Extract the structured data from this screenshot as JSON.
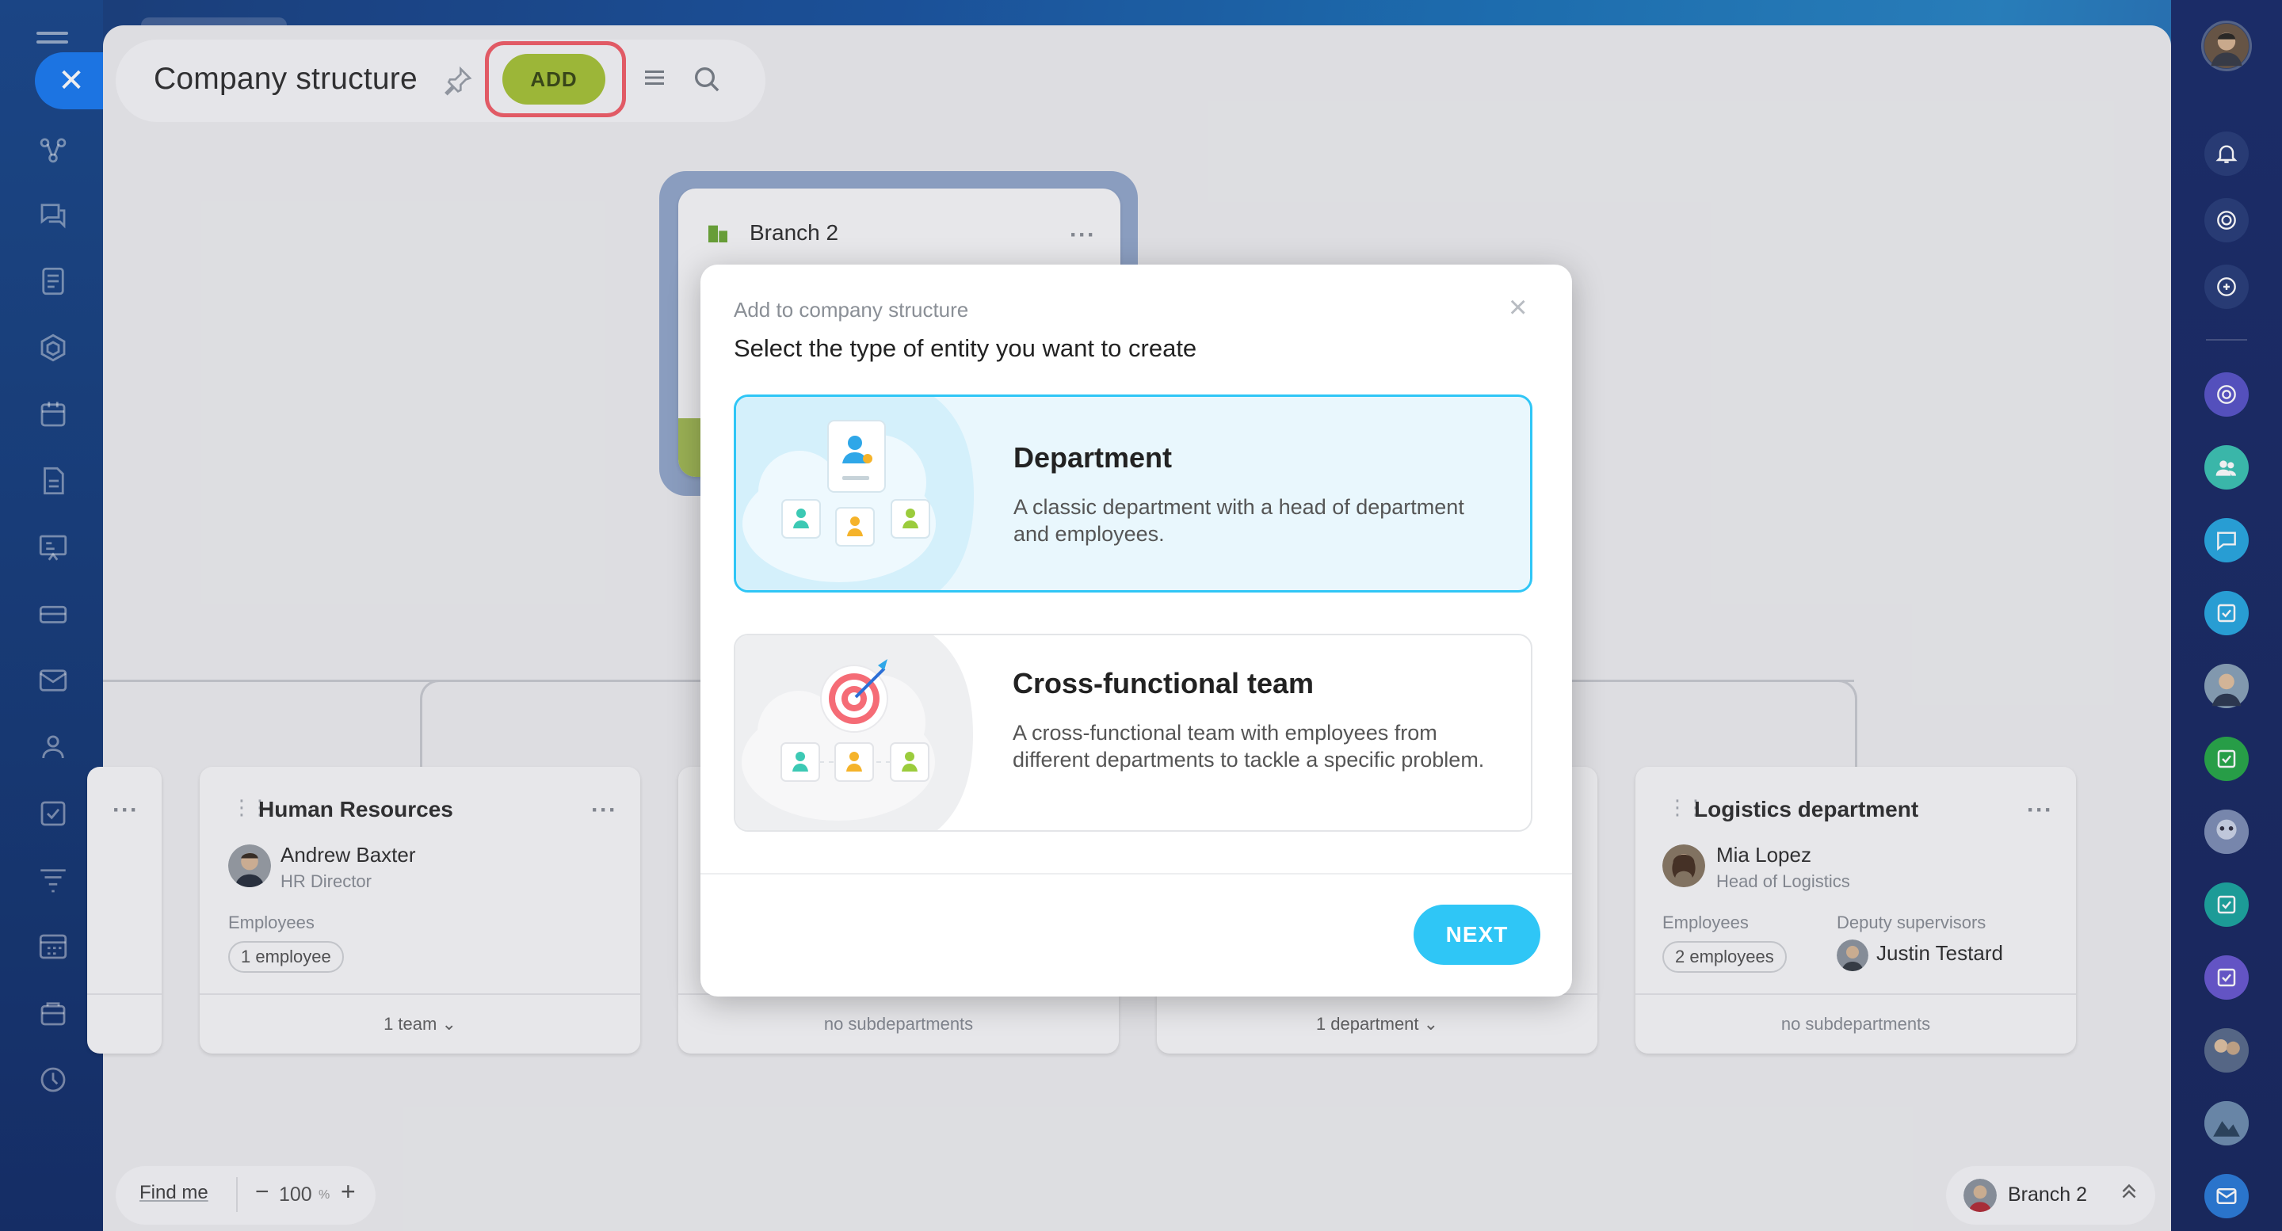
{
  "header": {
    "title": "Company structure",
    "add_label": "ADD"
  },
  "org": {
    "branch": {
      "title": "Branch 2"
    },
    "departments": [
      {
        "name": "Human Resources",
        "head_name": "Andrew Baxter",
        "head_role": "HR Director",
        "employees_label": "Employees",
        "employees_count": "1 employee",
        "footer": "1 team"
      },
      {
        "footer": "no subdepartments"
      },
      {
        "footer": "1 department"
      },
      {
        "name": "Logistics department",
        "head_name": "Mia Lopez",
        "head_role": "Head of Logistics",
        "employees_label": "Employees",
        "employees_count": "2 employees",
        "deputy_label": "Deputy supervisors",
        "deputy_name": "Justin Testard",
        "footer": "no subdepartments"
      }
    ]
  },
  "bottom": {
    "find_me": "Find me",
    "zoom_value": "100",
    "zoom_unit": "%",
    "minus": "−",
    "plus": "+",
    "branch_label": "Branch 2"
  },
  "modal": {
    "subtitle": "Add to company structure",
    "title": "Select the type of entity you want to create",
    "options": [
      {
        "title": "Department",
        "description": "A classic department with a head of department and employees.",
        "selected": true
      },
      {
        "title": "Cross-functional team",
        "description": "A cross-functional team with employees from different departments to tackle a specific problem.",
        "selected": false
      }
    ],
    "next_label": "NEXT"
  },
  "colors": {
    "accent": "#2fc6f6",
    "add_button": "#a7c33a",
    "highlight_outline": "#f2606a",
    "close_pill": "#1e7cf0"
  },
  "icons": {
    "left_rail": [
      "hamburger-icon",
      "close-icon",
      "flow-icon",
      "chat-icon",
      "feed-icon",
      "hexagon-icon",
      "calendar-icon",
      "document-icon",
      "board-icon",
      "drive-icon",
      "mail-icon",
      "group-icon",
      "task-icon",
      "filter-icon",
      "grid-calendar-icon",
      "store-icon",
      "circle-icon"
    ],
    "right_rail": [
      "bell-icon",
      "target-icon",
      "search-chat-icon",
      "copilot-icon",
      "group-chat-icon",
      "message-icon",
      "checkbox-icon"
    ]
  }
}
